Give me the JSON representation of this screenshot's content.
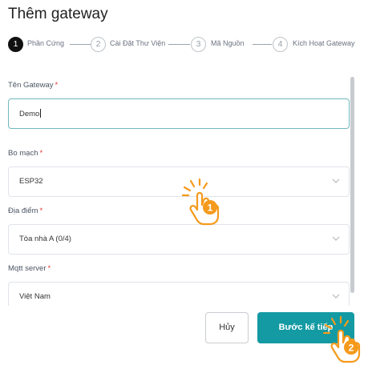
{
  "page": {
    "title": "Thêm gateway"
  },
  "steps": [
    {
      "number": "1",
      "label": "Phần Cứng",
      "active": true
    },
    {
      "number": "2",
      "label": "Cài Đặt Thư Viện",
      "active": false
    },
    {
      "number": "3",
      "label": "Mã Nguồn",
      "active": false
    },
    {
      "number": "4",
      "label": "Kích Hoạt Gateway",
      "active": false
    }
  ],
  "form": {
    "gateway_name": {
      "label": "Tên Gateway",
      "required_mark": "*",
      "value": "Demo"
    },
    "board": {
      "label": "Bo mạch",
      "required_mark": "*",
      "value": "ESP32"
    },
    "location": {
      "label": "Địa điểm",
      "required_mark": "*",
      "value": "Tòa nhà A (0/4)"
    },
    "mqtt_server": {
      "label": "Mqtt server",
      "required_mark": "*",
      "value": "Việt Nam"
    }
  },
  "buttons": {
    "cancel_label": "Hủy",
    "next_label": "Bước kế tiếp"
  },
  "annotations": [
    {
      "marker": "1",
      "icon": "tap-hand-icon"
    },
    {
      "marker": "2",
      "icon": "tap-hand-icon"
    }
  ],
  "colors": {
    "accent": "#139aa3",
    "hand_orange": "#f59a1b",
    "required": "#e53935"
  }
}
